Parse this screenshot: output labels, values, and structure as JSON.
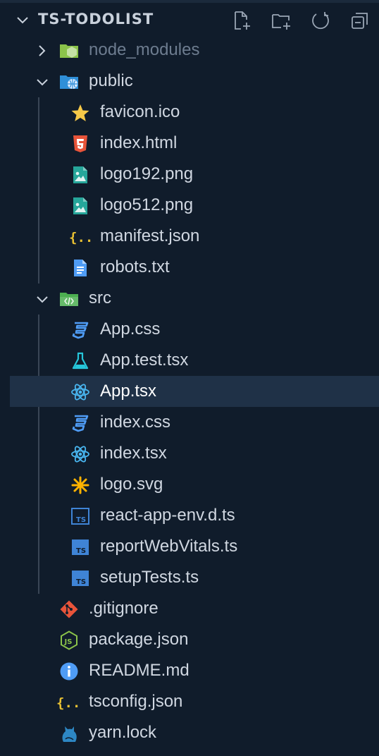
{
  "explorer": {
    "title": "TS-TODOLIST",
    "actions": [
      "new-file",
      "new-folder",
      "refresh",
      "collapse-all"
    ]
  },
  "tree": {
    "node_modules": "node_modules",
    "public": "public",
    "favicon": "favicon.ico",
    "index_html": "index.html",
    "logo192": "logo192.png",
    "logo512": "logo512.png",
    "manifest": "manifest.json",
    "robots": "robots.txt",
    "src": "src",
    "app_css": "App.css",
    "app_test": "App.test.tsx",
    "app_tsx": "App.tsx",
    "index_css": "index.css",
    "index_tsx": "index.tsx",
    "logo_svg": "logo.svg",
    "react_env": "react-app-env.d.ts",
    "report": "reportWebVitals.ts",
    "setup": "setupTests.ts",
    "gitignore": ".gitignore",
    "package": "package.json",
    "readme": "README.md",
    "tsconfig": "tsconfig.json",
    "yarn": "yarn.lock"
  },
  "selected": "App.tsx",
  "colors": {
    "background": "#101c2b",
    "selection": "#1f3147",
    "css": "#4f9cf5",
    "react": "#49b6f0",
    "ts": "#3f84d6",
    "html": "#e8543a",
    "json": "#e8c033",
    "git": "#e8543a",
    "node": "#8bc34a"
  }
}
